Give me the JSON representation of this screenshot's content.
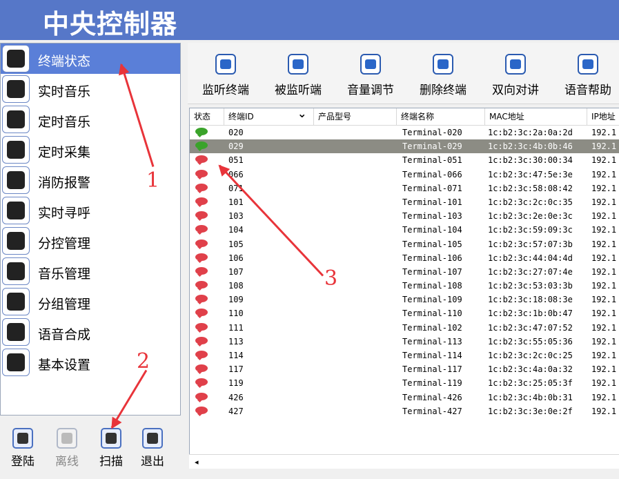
{
  "app": {
    "title": "中央控制器"
  },
  "sidebar": {
    "items": [
      {
        "label": "终端状态",
        "icon": "monitor-icon",
        "active": true
      },
      {
        "label": "实时音乐",
        "icon": "cd-music-icon"
      },
      {
        "label": "定时音乐",
        "icon": "radio-icon"
      },
      {
        "label": "定时采集",
        "icon": "stopwatch-icon"
      },
      {
        "label": "消防报警",
        "icon": "fire-extinguisher-icon"
      },
      {
        "label": "实时寻呼",
        "icon": "speaker-icon"
      },
      {
        "label": "分控管理",
        "icon": "user-manage-icon"
      },
      {
        "label": "音乐管理",
        "icon": "music-folder-icon"
      },
      {
        "label": "分组管理",
        "icon": "group-icon"
      },
      {
        "label": "语音合成",
        "icon": "voice-synthesis-icon"
      },
      {
        "label": "基本设置",
        "icon": "gear-icon"
      }
    ]
  },
  "bottom_buttons": [
    {
      "label": "登陆",
      "icon": "login-user-icon",
      "enabled": true
    },
    {
      "label": "离线",
      "icon": "offline-user-icon",
      "enabled": false
    },
    {
      "label": "扫描",
      "icon": "scan-icon",
      "enabled": true
    },
    {
      "label": "退出",
      "icon": "exit-door-icon",
      "enabled": true
    }
  ],
  "toolbar": [
    {
      "label": "监听终端",
      "icon": "monitor-terminal-icon"
    },
    {
      "label": "被监听端",
      "icon": "headset-icon"
    },
    {
      "label": "音量调节",
      "icon": "volume-icon"
    },
    {
      "label": "删除终端",
      "icon": "delete-terminal-icon"
    },
    {
      "label": "双向对讲",
      "icon": "intercom-phone-icon"
    },
    {
      "label": "语音帮助",
      "icon": "help-icon"
    }
  ],
  "table": {
    "columns": [
      "状态",
      "终端ID",
      "产品型号",
      "终端名称",
      "MAC地址",
      "IP地址"
    ],
    "rows": [
      {
        "status": "online",
        "id": "020",
        "model": "",
        "name": "Terminal-020",
        "mac": "1c:b2:3c:2a:0a:2d",
        "ip": "192.1"
      },
      {
        "status": "online",
        "id": "029",
        "model": "",
        "name": "Terminal-029",
        "mac": "1c:b2:3c:4b:0b:46",
        "ip": "192.1",
        "selected": true
      },
      {
        "status": "offline",
        "id": "051",
        "model": "",
        "name": "Terminal-051",
        "mac": "1c:b2:3c:30:00:34",
        "ip": "192.1"
      },
      {
        "status": "offline",
        "id": "066",
        "model": "",
        "name": "Terminal-066",
        "mac": "1c:b2:3c:47:5e:3e",
        "ip": "192.1"
      },
      {
        "status": "offline",
        "id": "071",
        "model": "",
        "name": "Terminal-071",
        "mac": "1c:b2:3c:58:08:42",
        "ip": "192.1"
      },
      {
        "status": "offline",
        "id": "101",
        "model": "",
        "name": "Terminal-101",
        "mac": "1c:b2:3c:2c:0c:35",
        "ip": "192.1"
      },
      {
        "status": "offline",
        "id": "103",
        "model": "",
        "name": "Terminal-103",
        "mac": "1c:b2:3c:2e:0e:3c",
        "ip": "192.1"
      },
      {
        "status": "offline",
        "id": "104",
        "model": "",
        "name": "Terminal-104",
        "mac": "1c:b2:3c:59:09:3c",
        "ip": "192.1"
      },
      {
        "status": "offline",
        "id": "105",
        "model": "",
        "name": "Terminal-105",
        "mac": "1c:b2:3c:57:07:3b",
        "ip": "192.1"
      },
      {
        "status": "offline",
        "id": "106",
        "model": "",
        "name": "Terminal-106",
        "mac": "1c:b2:3c:44:04:4d",
        "ip": "192.1"
      },
      {
        "status": "offline",
        "id": "107",
        "model": "",
        "name": "Terminal-107",
        "mac": "1c:b2:3c:27:07:4e",
        "ip": "192.1"
      },
      {
        "status": "offline",
        "id": "108",
        "model": "",
        "name": "Terminal-108",
        "mac": "1c:b2:3c:53:03:3b",
        "ip": "192.1"
      },
      {
        "status": "offline",
        "id": "109",
        "model": "",
        "name": "Terminal-109",
        "mac": "1c:b2:3c:18:08:3e",
        "ip": "192.1"
      },
      {
        "status": "offline",
        "id": "110",
        "model": "",
        "name": "Terminal-110",
        "mac": "1c:b2:3c:1b:0b:47",
        "ip": "192.1"
      },
      {
        "status": "offline",
        "id": "111",
        "model": "",
        "name": "Terminal-102",
        "mac": "1c:b2:3c:47:07:52",
        "ip": "192.1"
      },
      {
        "status": "offline",
        "id": "113",
        "model": "",
        "name": "Terminal-113",
        "mac": "1c:b2:3c:55:05:36",
        "ip": "192.1"
      },
      {
        "status": "offline",
        "id": "114",
        "model": "",
        "name": "Terminal-114",
        "mac": "1c:b2:3c:2c:0c:25",
        "ip": "192.1"
      },
      {
        "status": "offline",
        "id": "117",
        "model": "",
        "name": "Terminal-117",
        "mac": "1c:b2:3c:4a:0a:32",
        "ip": "192.1"
      },
      {
        "status": "offline",
        "id": "119",
        "model": "",
        "name": "Terminal-119",
        "mac": "1c:b2:3c:25:05:3f",
        "ip": "192.1"
      },
      {
        "status": "offline",
        "id": "426",
        "model": "",
        "name": "Terminal-426",
        "mac": "1c:b2:3c:4b:0b:31",
        "ip": "192.1"
      },
      {
        "status": "offline",
        "id": "427",
        "model": "",
        "name": "Terminal-427",
        "mac": "1c:b2:3c:3e:0e:2f",
        "ip": "192.1"
      }
    ]
  },
  "scrollbar": {
    "left_arrow": "◂"
  },
  "annotations": [
    {
      "number": "1",
      "color": "#e8343a"
    },
    {
      "number": "2",
      "color": "#e8343a"
    },
    {
      "number": "3",
      "color": "#e8343a"
    }
  ],
  "colors": {
    "titlebar": "#5677c8",
    "active_nav": "#5a7fd8",
    "online": "#3aa32a",
    "offline": "#e0404a",
    "selected_row": "#8c8c84"
  }
}
